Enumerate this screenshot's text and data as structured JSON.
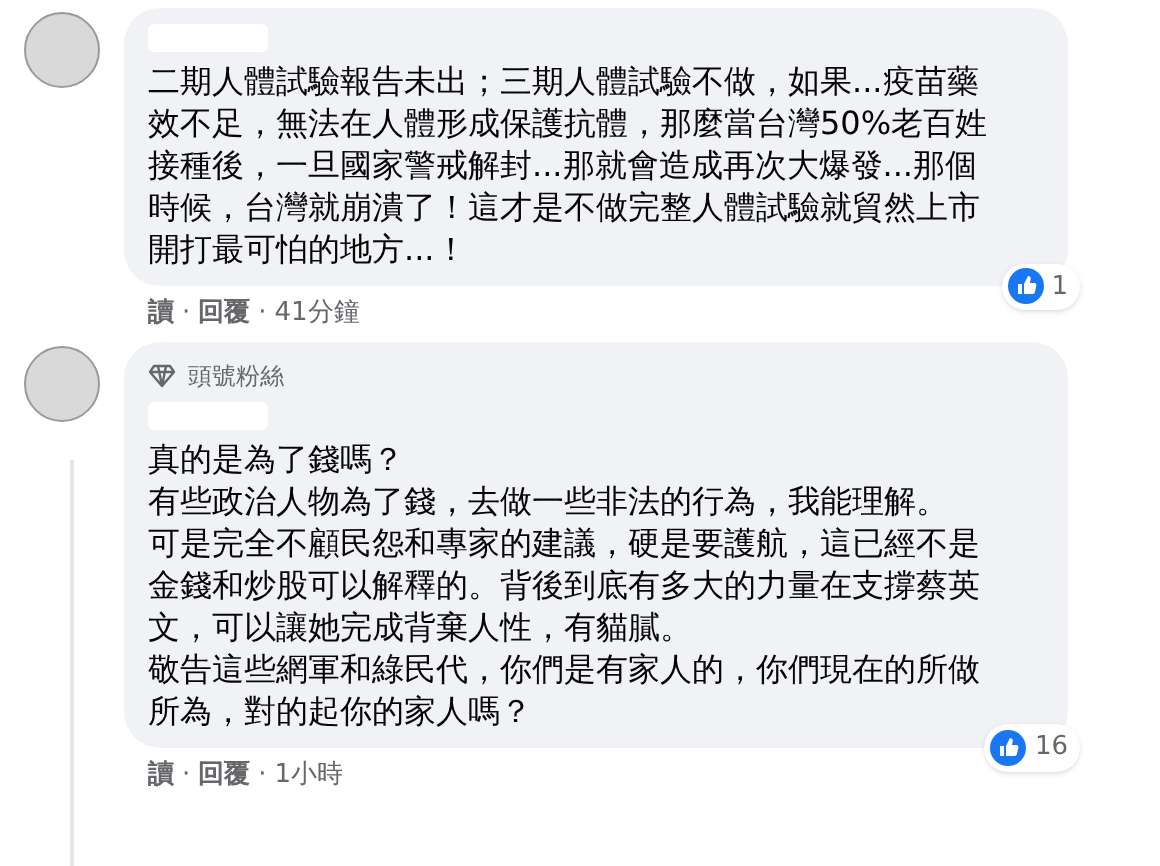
{
  "comments": [
    {
      "paragraphs": [
        "二期人體試驗報告未出；三期人體試驗不做，如果...疫苗藥效不足，無法在人體形成保護抗體，那麼當台灣50%老百姓接種後，一旦國家警戒解封...那就會造成再次大爆發...那個時候，台灣就崩潰了！這才是不做完整人體試驗就貿然上市開打最可怕的地方...！"
      ],
      "actions": [
        "讀",
        "回覆",
        "41分鐘"
      ],
      "separator": "·",
      "reaction_count": "1"
    },
    {
      "badge": "頭號粉絲",
      "paragraphs": [
        "真的是為了錢嗎？",
        "有些政治人物為了錢，去做一些非法的行為，我能理解。",
        "可是完全不顧民怨和專家的建議，硬是要護航，這已經不是金錢和炒股可以解釋的。背後到底有多大的力量在支撐蔡英文，可以讓她完成背棄人性，有貓膩。",
        "敬告這些網軍和綠民代，你們是有家人的，你們現在的所做所為，對的起你的家人嗎？"
      ],
      "actions": [
        "讀",
        "回覆",
        "1小時"
      ],
      "separator": "·",
      "reaction_count": "16"
    }
  ]
}
